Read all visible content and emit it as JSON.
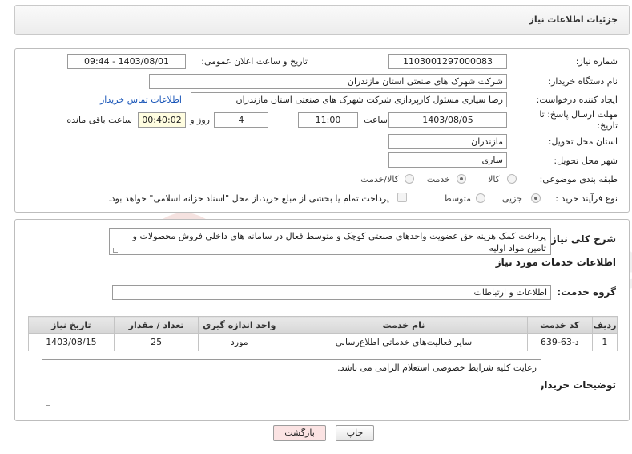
{
  "header": {
    "title": "جزئیات اطلاعات نیاز"
  },
  "form": {
    "need_number_label": "شماره نیاز:",
    "need_number": "1103001297000083",
    "announce_label": "تاریخ و ساعت اعلان عمومی:",
    "announce_value": "1403/08/01 - 09:44",
    "buyer_org_label": "نام دستگاه خریدار:",
    "buyer_org": "شرکت شهرک های صنعتی استان مازندران",
    "creator_label": "ایجاد کننده درخواست:",
    "creator": "رضا سیاری مسئول کارپردازی شرکت شهرک های صنعتی استان مازندران",
    "contact_link": "اطلاعات تماس خریدار",
    "deadline_label": "مهلت ارسال پاسخ: تا تاریخ:",
    "deadline_date": "1403/08/05",
    "time_label": "ساعت",
    "deadline_time": "11:00",
    "days_value": "4",
    "days_label": "روز و",
    "remaining_time": "00:40:02",
    "remaining_label": "ساعت باقی مانده",
    "province_label": "استان محل تحویل:",
    "province": "مازندران",
    "city_label": "شهر محل تحویل:",
    "city": "ساری",
    "category_label": "طبقه بندی موضوعی:",
    "category_options": [
      "کالا",
      "خدمت",
      "کالا/خدمت"
    ],
    "category_selected": "خدمت",
    "process_label": "نوع فرآیند خرید :",
    "process_options": [
      "جزیی",
      "متوسط"
    ],
    "process_selected": "جزیی",
    "payment_note": "پرداخت تمام یا بخشی از مبلغ خرید،از محل \"اسناد خزانه اسلامی\" خواهد بود."
  },
  "description": {
    "label": "شرح کلی نیاز:",
    "text": "پرداخت کمک هزینه حق عضویت واحدهای صنعتی کوچک و متوسط فعال در سامانه های داخلی فروش محصولات و تامین مواد اولیه"
  },
  "services": {
    "section_title": "اطلاعات خدمات مورد نیاز",
    "group_label": "گروه خدمت:",
    "group_value": "اطلاعات و ارتباطات",
    "columns": [
      "ردیف",
      "کد خدمت",
      "نام خدمت",
      "واحد اندازه گیری",
      "تعداد / مقدار",
      "تاریخ نیاز"
    ],
    "rows": [
      [
        "1",
        "د-63-639",
        "سایر فعالیت‌های خدماتی اطلاع‌رسانی",
        "مورد",
        "25",
        "1403/08/15"
      ]
    ]
  },
  "buyer_notes": {
    "label": "توضیحات خریدار:",
    "text": "رعایت کلیه شرایط خصوصی استعلام الزامی می باشد."
  },
  "buttons": {
    "print": "چاپ",
    "back": "بازگشت"
  },
  "watermark": {
    "text": "AriaTender.net"
  },
  "colors": {
    "link": "#1a56b8",
    "back_button": "#fbe3e3",
    "yellow_field": "#fffde0"
  }
}
